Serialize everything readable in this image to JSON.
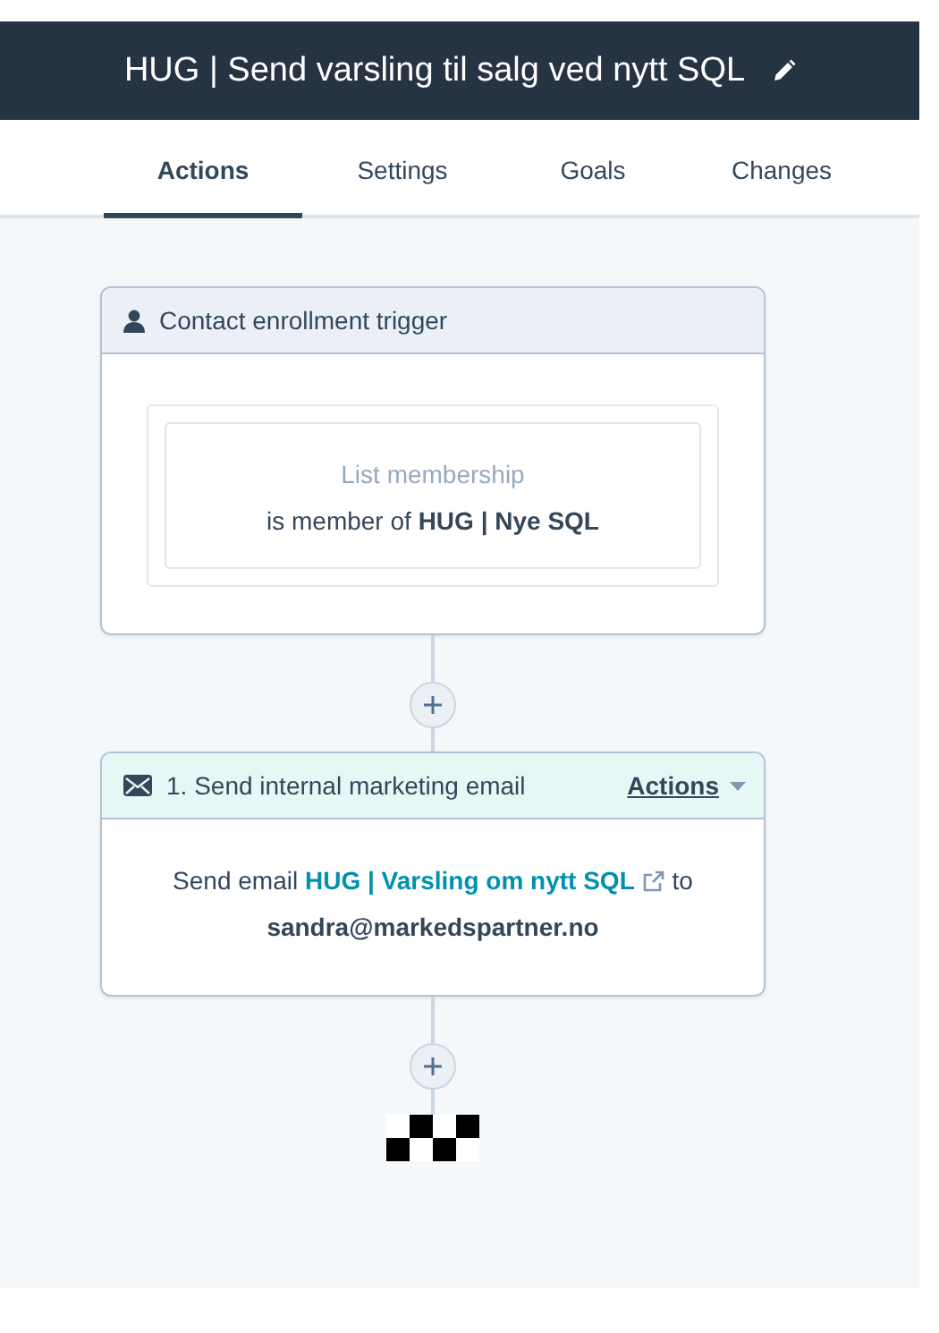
{
  "header": {
    "title": "HUG | Send varsling til salg ved nytt SQL"
  },
  "tabs": [
    {
      "label": "Actions",
      "selected": true
    },
    {
      "label": "Settings",
      "selected": false
    },
    {
      "label": "Goals",
      "selected": false
    },
    {
      "label": "Changes",
      "selected": false
    }
  ],
  "trigger": {
    "title": "Contact enrollment trigger",
    "filter_label": "List membership",
    "filter_text": "is member of **HUG | Nye SQL**"
  },
  "action": {
    "title": "1. Send internal marketing email",
    "menu": "Actions",
    "prefix": "Send email",
    "email_link": "HUG | Varsling om nytt SQL",
    "suffix": "to",
    "recipient": "sandra@markedspartner.no"
  }
}
